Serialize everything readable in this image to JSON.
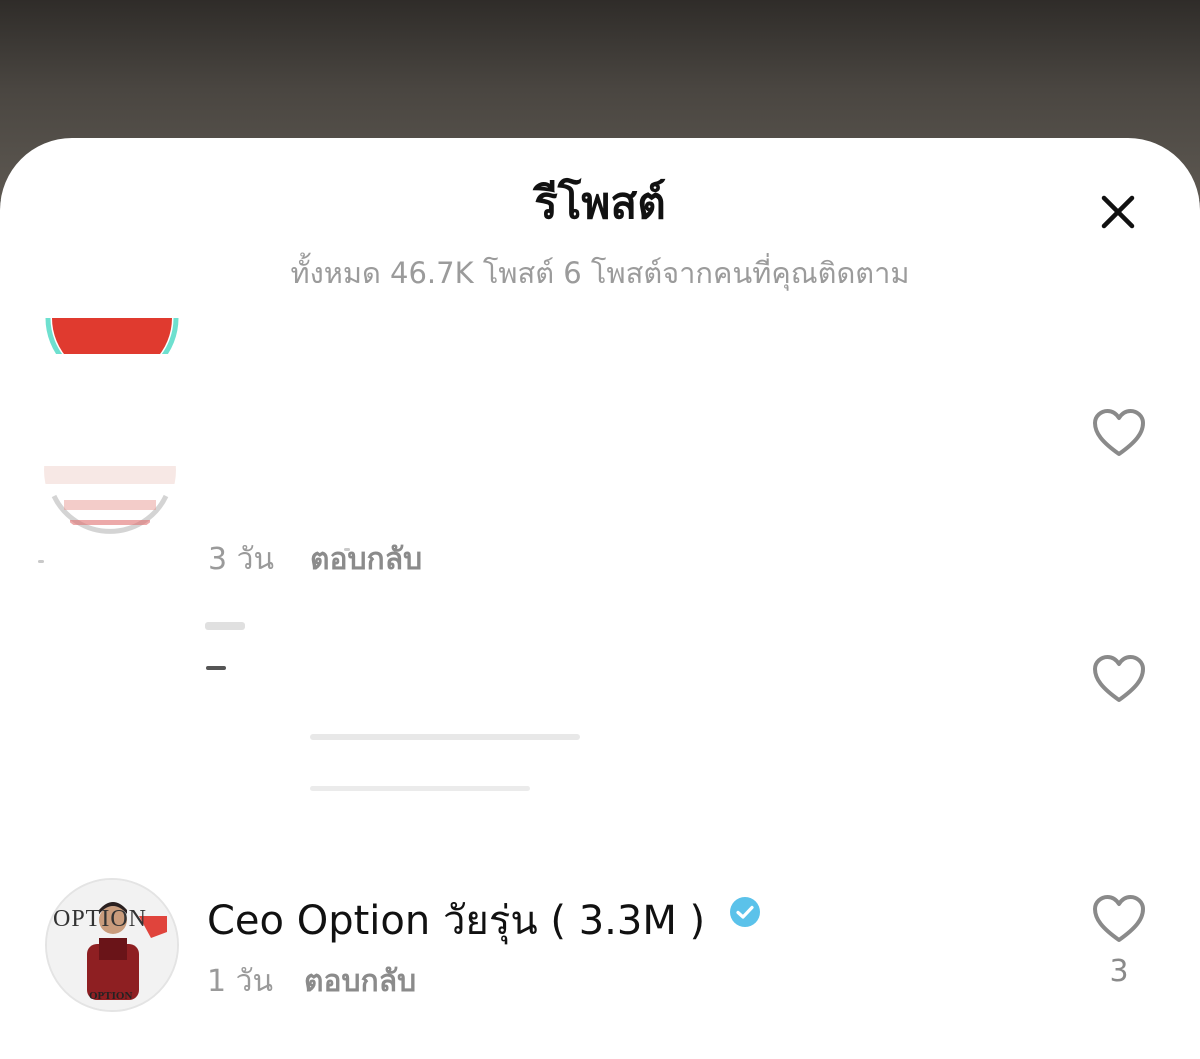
{
  "sheet": {
    "title": "รีโพสต์",
    "subtitle": "ทั้งหมด 46.7K โพสต์ 6 โพสต์จากคนที่คุณติดตาม"
  },
  "comments": [
    {
      "time": "3 วัน",
      "reply_label": "ตอบกลับ"
    },
    {
      "username": "Ceo Option วัยรุ่น ( 3.3M )",
      "verified": true,
      "avatar_logo": "OPTION",
      "avatar_caption": "OPTION",
      "time": "1 วัน",
      "reply_label": "ตอบกลับ",
      "like_count": "3"
    }
  ],
  "colors": {
    "verified_badge": "#5bc2ea",
    "heart_outline": "#8a8a8a",
    "ring_teal": "#6ee0cf",
    "ring_red": "#e03a2f"
  }
}
